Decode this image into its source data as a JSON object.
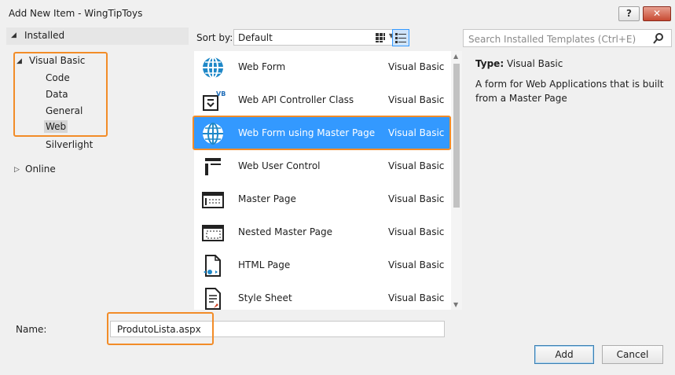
{
  "window": {
    "title": "Add New Item - WingTipToys",
    "help_label": "?",
    "close_label": "✕"
  },
  "tree": {
    "installed": "Installed",
    "visual_basic": "Visual Basic",
    "children": [
      "Code",
      "Data",
      "General",
      "Web",
      "Silverlight"
    ],
    "selected_child": "Web",
    "online": "Online"
  },
  "sort": {
    "label": "Sort by:",
    "value": "Default"
  },
  "templates": [
    {
      "name": "Web Form",
      "lang": "Visual Basic",
      "icon": "globe-icon"
    },
    {
      "name": "Web API Controller Class",
      "lang": "Visual Basic",
      "icon": "vb-controller-icon"
    },
    {
      "name": "Web Form using Master Page",
      "lang": "Visual Basic",
      "icon": "globe-icon",
      "selected": true
    },
    {
      "name": "Web User Control",
      "lang": "Visual Basic",
      "icon": "user-control-icon"
    },
    {
      "name": "Master Page",
      "lang": "Visual Basic",
      "icon": "master-page-icon"
    },
    {
      "name": "Nested Master Page",
      "lang": "Visual Basic",
      "icon": "nested-master-page-icon"
    },
    {
      "name": "HTML Page",
      "lang": "Visual Basic",
      "icon": "html-page-icon"
    },
    {
      "name": "Style Sheet",
      "lang": "Visual Basic",
      "icon": "style-sheet-icon"
    }
  ],
  "search": {
    "placeholder": "Search Installed Templates (Ctrl+E)"
  },
  "details": {
    "type_label": "Type:",
    "type_value": "Visual Basic",
    "description": "A form for Web Applications that is built from a Master Page"
  },
  "name_field": {
    "label": "Name:",
    "value": "ProdutoLista.aspx"
  },
  "buttons": {
    "add": "Add",
    "cancel": "Cancel"
  },
  "colors": {
    "selection": "#3399ff",
    "highlight_box": "#f28c28"
  }
}
